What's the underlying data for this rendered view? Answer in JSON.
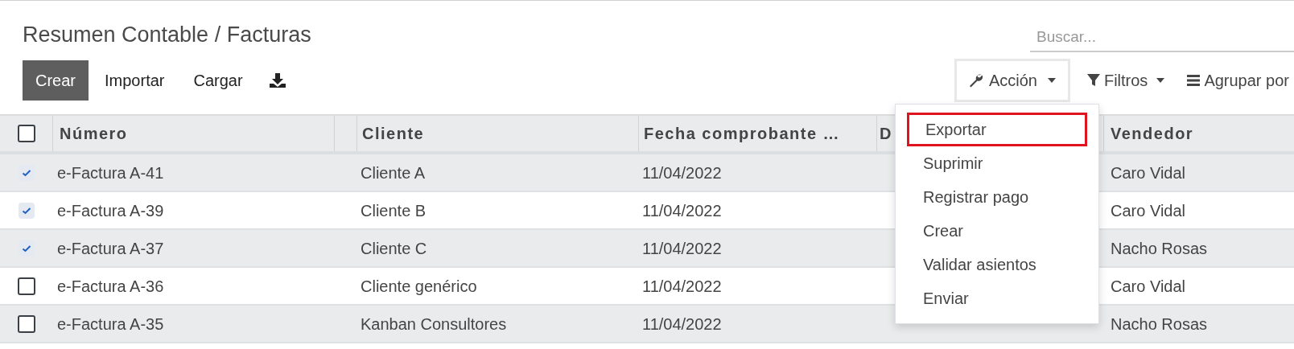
{
  "breadcrumb": "Resumen Contable / Facturas",
  "search": {
    "placeholder": "Buscar..."
  },
  "toolbar": {
    "create": "Crear",
    "import": "Importar",
    "upload": "Cargar"
  },
  "action_menu": {
    "label": "Acción",
    "open": true,
    "items": [
      {
        "label": "Exportar",
        "highlighted": true
      },
      {
        "label": "Suprimir",
        "highlighted": false
      },
      {
        "label": "Registrar pago",
        "highlighted": false
      },
      {
        "label": "Crear",
        "highlighted": false
      },
      {
        "label": "Validar asientos",
        "highlighted": false
      },
      {
        "label": "Enviar",
        "highlighted": false
      }
    ]
  },
  "filters": "Filtros",
  "group_by": "Agrupar por",
  "table": {
    "all_selected": false,
    "columns": {
      "number": "Número",
      "client": "Cliente",
      "date": "Fecha comprobante …",
      "column_5": "D",
      "seller": "Vendedor"
    },
    "rows": [
      {
        "selected": true,
        "number": "e-Factura A-41",
        "client": "Cliente A",
        "date": "11/04/2022",
        "seller": "Caro Vidal"
      },
      {
        "selected": true,
        "number": "e-Factura A-39",
        "client": "Cliente B",
        "date": "11/04/2022",
        "seller": "Caro Vidal"
      },
      {
        "selected": true,
        "number": "e-Factura A-37",
        "client": "Cliente C",
        "date": "11/04/2022",
        "seller": "Nacho Rosas"
      },
      {
        "selected": false,
        "number": "e-Factura A-36",
        "client": "Cliente genérico",
        "date": "11/04/2022",
        "seller": "Caro Vidal"
      },
      {
        "selected": false,
        "number": "e-Factura A-35",
        "client": "Kanban Consultores",
        "date": "11/04/2022",
        "seller": "Nacho Rosas"
      }
    ]
  }
}
